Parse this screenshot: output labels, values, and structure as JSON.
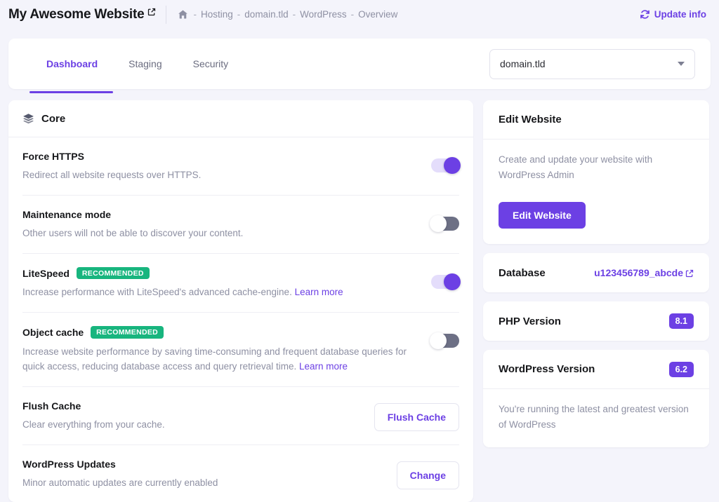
{
  "topbar": {
    "site_title": "My Awesome Website",
    "site_title_icon": "external-link-icon",
    "breadcrumb": {
      "home_icon": "home-icon",
      "separator": "-",
      "items": [
        "Hosting",
        "domain.tld",
        "WordPress",
        "Overview"
      ]
    },
    "update_info_label": "Update info",
    "update_info_icon": "refresh-icon"
  },
  "tabs": {
    "items": [
      {
        "label": "Dashboard",
        "active": true
      },
      {
        "label": "Staging",
        "active": false
      },
      {
        "label": "Security",
        "active": false
      }
    ],
    "domain_select": {
      "value": "domain.tld",
      "icon": "chevron-down-icon"
    }
  },
  "core": {
    "title": "Core",
    "icon": "layers-icon",
    "rows": [
      {
        "title": "Force HTTPS",
        "desc": "Redirect all website requests over HTTPS.",
        "control": "toggle",
        "toggle_state": "on"
      },
      {
        "title": "Maintenance mode",
        "desc": "Other users will not be able to discover your content.",
        "control": "toggle",
        "toggle_state": "off"
      },
      {
        "title": "LiteSpeed",
        "badge": "RECOMMENDED",
        "desc": "Increase performance with LiteSpeed's advanced cache-engine. ",
        "link": "Learn more",
        "control": "toggle",
        "toggle_state": "on"
      },
      {
        "title": "Object cache",
        "badge": "RECOMMENDED",
        "desc": "Increase website performance by saving time-consuming and frequent database queries for quick access, reducing database access and query retrieval time. ",
        "link": "Learn more",
        "control": "toggle",
        "toggle_state": "off"
      },
      {
        "title": "Flush Cache",
        "desc": "Clear everything from your cache.",
        "control": "button",
        "button_label": "Flush Cache"
      },
      {
        "title": "WordPress Updates",
        "desc": "Minor automatic updates are currently enabled",
        "control": "button",
        "button_label": "Change"
      }
    ]
  },
  "sidebar": {
    "edit_website": {
      "title": "Edit Website",
      "description": "Create and update your website with WordPress Admin",
      "button_label": "Edit Website"
    },
    "database": {
      "title": "Database",
      "value": "u123456789_abcde",
      "icon": "external-link-icon"
    },
    "php_version": {
      "title": "PHP Version",
      "value": "8.1"
    },
    "wordpress_version": {
      "title": "WordPress Version",
      "value": "6.2",
      "description": "You're running the latest and greatest version of WordPress"
    }
  },
  "colors": {
    "accent": "#6c40e4",
    "success": "#18b57e",
    "page_bg": "#f4f4fb",
    "muted_text": "#8e90a3",
    "toggle_off": "#6d7085"
  }
}
